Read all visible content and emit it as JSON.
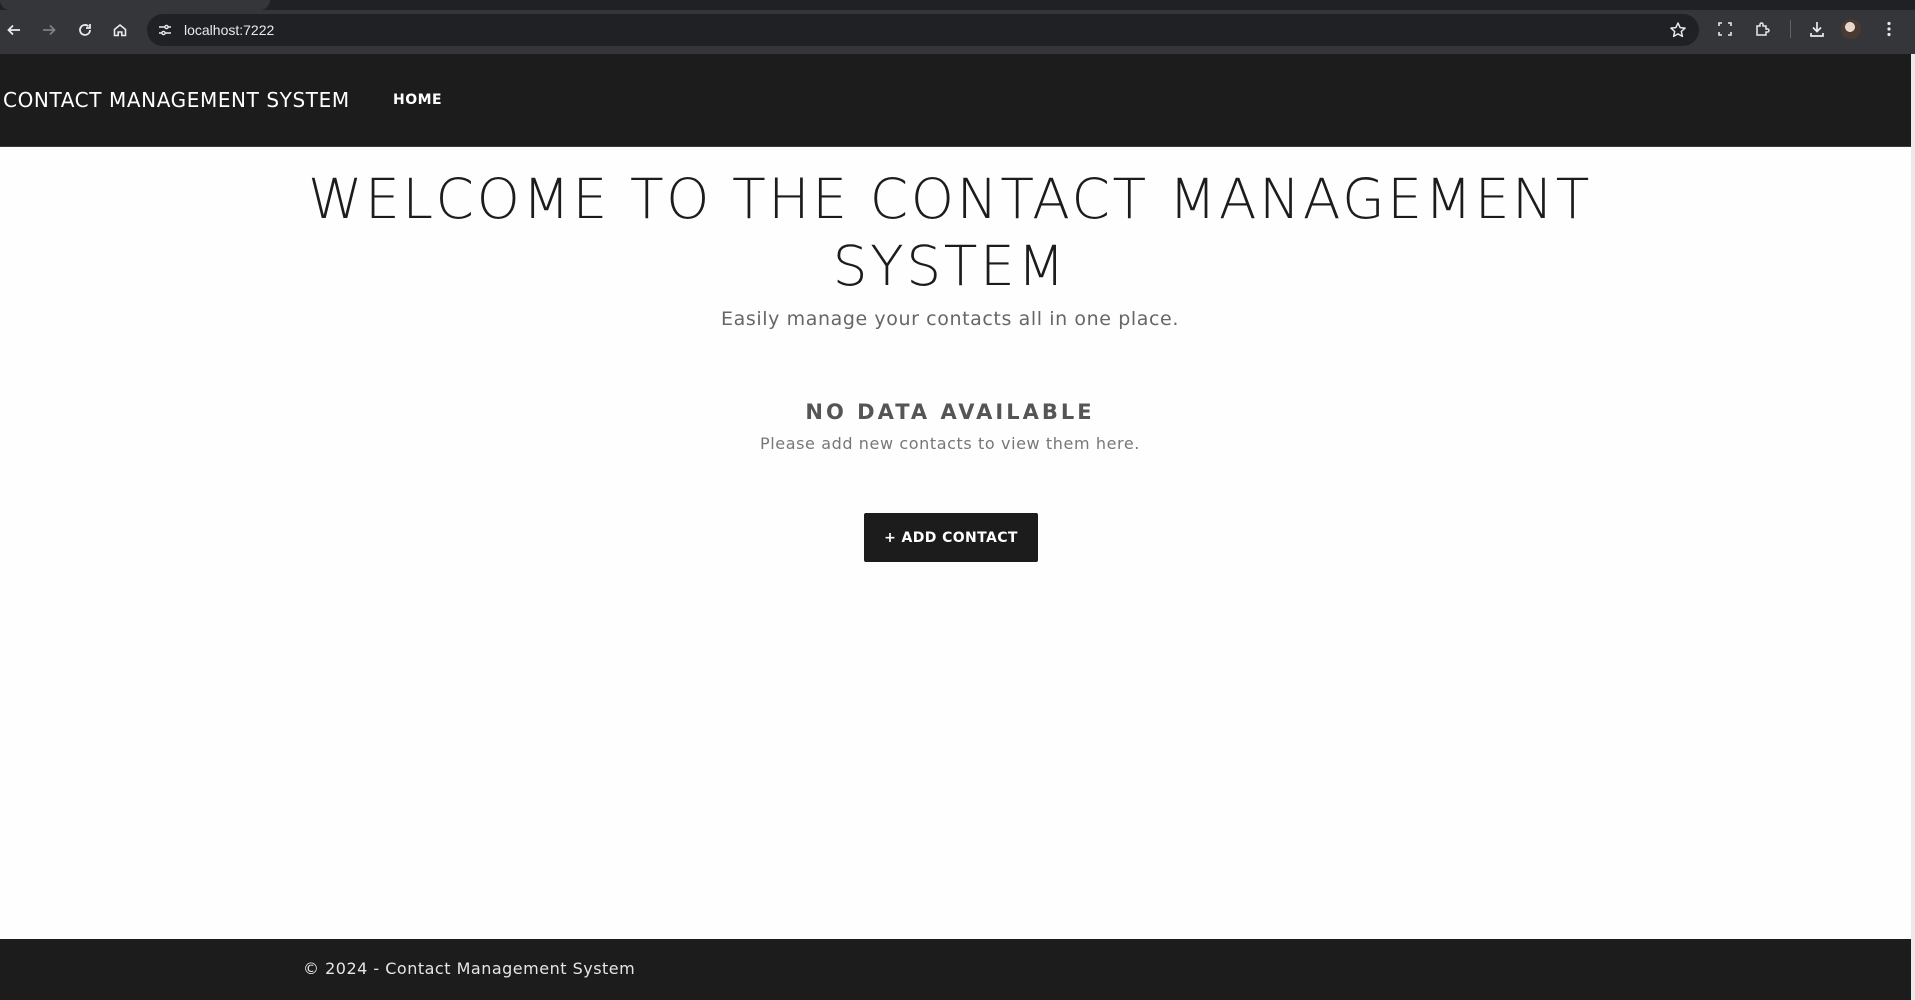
{
  "browser": {
    "url": "localhost:7222",
    "icons": [
      "back-arrow-icon",
      "forward-arrow-icon",
      "reload-icon",
      "home-icon",
      "site-settings-icon",
      "bookmark-star-icon",
      "screenshot-icon",
      "extensions-icon",
      "download-icon",
      "profile-avatar",
      "more-menu-icon"
    ]
  },
  "navbar": {
    "brand": "CONTACT MANAGEMENT SYSTEM",
    "links": [
      {
        "label": "HOME"
      }
    ]
  },
  "main": {
    "title": "WELCOME TO THE CONTACT MANAGEMENT SYSTEM",
    "subtitle": "Easily manage your contacts all in one place.",
    "empty_state": {
      "title": "NO DATA AVAILABLE",
      "message": "Please add new contacts to view them here."
    },
    "add_button": "+ ADD CONTACT"
  },
  "footer": {
    "text": "© 2024 - Contact Management System"
  },
  "colors": {
    "dark": "#1c1c1c",
    "page_bg": "#fefefe",
    "chrome": "#35363a"
  }
}
